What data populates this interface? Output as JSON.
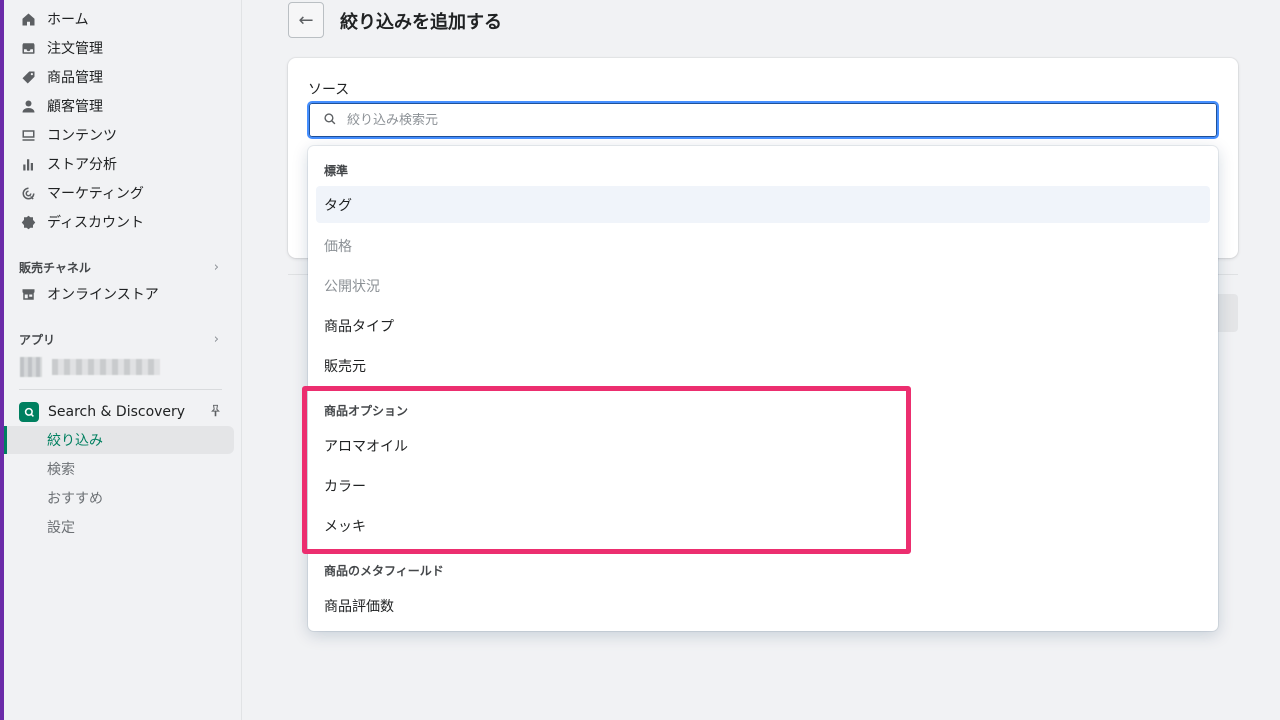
{
  "sidebar": {
    "nav": [
      {
        "label": "ホーム",
        "icon": "home-icon"
      },
      {
        "label": "注文管理",
        "icon": "inbox-icon"
      },
      {
        "label": "商品管理",
        "icon": "tag-icon"
      },
      {
        "label": "顧客管理",
        "icon": "person-icon"
      },
      {
        "label": "コンテンツ",
        "icon": "content-icon"
      },
      {
        "label": "ストア分析",
        "icon": "bar-chart-icon"
      },
      {
        "label": "マーケティング",
        "icon": "target-icon"
      },
      {
        "label": "ディスカウント",
        "icon": "discount-icon"
      }
    ],
    "sales_channels_title": "販売チャネル",
    "online_store": "オンラインストア",
    "apps_title": "アプリ",
    "app_name": "Search & Discovery",
    "app_sub": [
      "絞り込み",
      "検索",
      "おすすめ",
      "設定"
    ]
  },
  "header": {
    "title": "絞り込みを追加する"
  },
  "form": {
    "source_label": "ソース",
    "search_placeholder": "絞り込み検索元"
  },
  "dropdown": {
    "groups": [
      {
        "title": "標準",
        "options": [
          {
            "label": "タグ",
            "state": "highlighted"
          },
          {
            "label": "価格",
            "state": "disabled"
          },
          {
            "label": "公開状況",
            "state": "disabled"
          },
          {
            "label": "商品タイプ",
            "state": "normal"
          },
          {
            "label": "販売元",
            "state": "normal"
          }
        ]
      },
      {
        "title": "商品オプション",
        "options": [
          {
            "label": "アロマオイル"
          },
          {
            "label": "カラー"
          },
          {
            "label": "メッキ"
          }
        ]
      },
      {
        "title": "商品のメタフィールド",
        "options": [
          {
            "label": "商品評価数"
          }
        ]
      }
    ]
  },
  "colors": {
    "accent": "#008060",
    "focus": "#458fff",
    "annotation": "#ec2e6f",
    "sidebar_stripe": "#6b2ba8"
  }
}
